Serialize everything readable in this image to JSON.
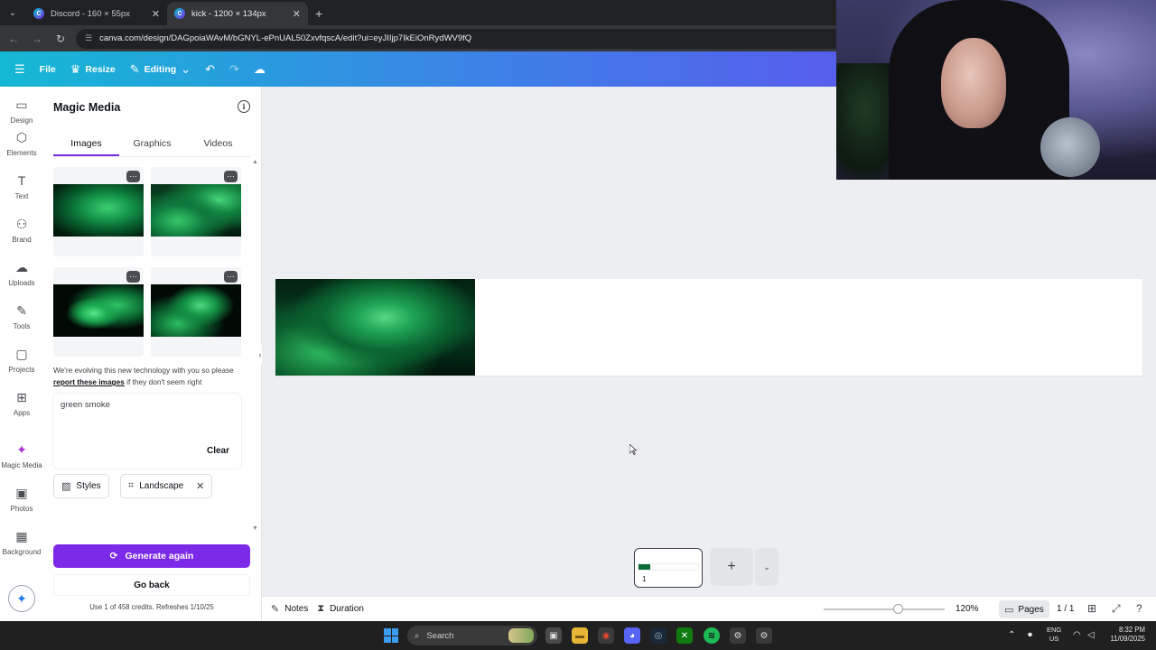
{
  "browser": {
    "tabs": [
      {
        "title": "Discord - 160 × 55px",
        "active": false
      },
      {
        "title": "kick - 1200 × 134px",
        "active": true
      }
    ],
    "url": "canva.com/design/DAGpoiaWAvM/bGNYL-ePnUAL50ZxvfqscA/edit?ui=eyJIIjp7IkEiOnRydWV9fQ"
  },
  "toolbar": {
    "file_label": "File",
    "resize_label": "Resize",
    "editing_label": "Editing"
  },
  "rail": {
    "items": [
      {
        "label": "Design",
        "icon": "design-icon",
        "glyph": "▭",
        "active": false
      },
      {
        "label": "Elements",
        "icon": "shapes-icon",
        "glyph": "⬡",
        "active": false
      },
      {
        "label": "Text",
        "icon": "text-icon",
        "glyph": "T",
        "active": false
      },
      {
        "label": "Brand",
        "icon": "brand-icon",
        "glyph": "⚇",
        "active": false
      },
      {
        "label": "Uploads",
        "icon": "cloud-upload-icon",
        "glyph": "☁",
        "active": false
      },
      {
        "label": "Tools",
        "icon": "pencil-icon",
        "glyph": "✎",
        "active": false
      },
      {
        "label": "Projects",
        "icon": "folder-icon",
        "glyph": "▢",
        "active": false
      },
      {
        "label": "Apps",
        "icon": "apps-icon",
        "glyph": "⊞",
        "active": false
      },
      {
        "label": "Magic Media",
        "icon": "magic-media-icon",
        "glyph": "✦",
        "active": true
      },
      {
        "label": "Photos",
        "icon": "photo-icon",
        "glyph": "▣",
        "active": false
      },
      {
        "label": "Background",
        "icon": "background-icon",
        "glyph": "▦",
        "active": false
      }
    ]
  },
  "panel": {
    "title": "Magic Media",
    "tabs": [
      {
        "label": "Images",
        "active": true
      },
      {
        "label": "Graphics",
        "active": false
      },
      {
        "label": "Videos",
        "active": false
      }
    ],
    "notice_before": "We're evolving this new technology with you so please ",
    "notice_link": "report these images",
    "notice_after": " if they don't seem right",
    "prompt": "green smoke",
    "clear_label": "Clear",
    "styles_label": "Styles",
    "aspect_label": "Landscape",
    "generate_label": "Generate again",
    "back_label": "Go back",
    "credits": "Use 1 of 458 credits. Refreshes 1/10/25"
  },
  "canvas": {
    "page_number": "1"
  },
  "footer": {
    "notes_label": "Notes",
    "duration_label": "Duration",
    "zoom": "120%",
    "pages_label": "Pages",
    "page_count": "1 / 1"
  },
  "taskbar": {
    "search_label": "Search",
    "lang_line1": "ENG",
    "lang_line2": "US",
    "time": "8:32 PM",
    "date": "11/09/2025"
  },
  "colors": {
    "accent": "#7d2ae8",
    "toolbar_start": "#14b8d4",
    "toolbar_end": "#6f3ef0"
  }
}
